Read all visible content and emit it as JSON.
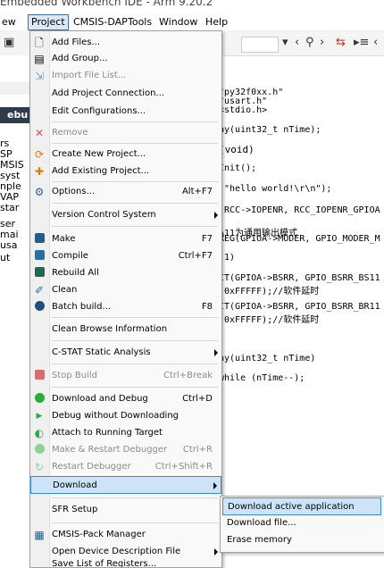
{
  "window": {
    "title": "Embedded Workbench IDE - Arm 9.20.2"
  },
  "menubar": [
    "ew",
    "Project",
    "CMSIS-DAP",
    "Tools",
    "Window",
    "Help"
  ],
  "left_tree": [
    "rs",
    "SP",
    "MSIS",
    "syst",
    "nple",
    "VAP",
    "star",
    "ser",
    "mai",
    "usa",
    "ut"
  ],
  "left_header": "ebu",
  "code_lines": [
    {
      "text": "\"py32f0xx.h\"",
      "cls": "s"
    },
    {
      "text": "\"usart.h\"",
      "cls": "s"
    },
    {
      "text": "<stdio.h>",
      "cls": "s"
    },
    {
      "text": "ay(uint32_t nTime);",
      "cls": ""
    },
    {
      "text": "(void)",
      "cls": "k"
    },
    {
      "text": "Init();",
      "cls": ""
    },
    {
      "text": "(\"hello world!\\r\\n\");",
      "cls": "s"
    },
    {
      "text": "(RCC->IOPENR, RCC_IOPENR_GPIOA",
      "cls": ""
    },
    {
      "text": "A11为通用输出模式",
      "cls": "c"
    },
    {
      "text": "REG(GPIOA->MODER, GPIO_MODER_M",
      "cls": ""
    },
    {
      "text": "(1)",
      "cls": ""
    },
    {
      "text": "IT(GPIOA->BSRR, GPIO_BSRR_BS11",
      "cls": ""
    },
    {
      "text": "(0xFFFFF);//软件延时",
      "cls": "c"
    },
    {
      "text": "IT(GPIOA->BSRR, GPIO_BSRR_BR11",
      "cls": ""
    },
    {
      "text": "(0xFFFFF);//软件延时",
      "cls": "c"
    },
    {
      "text": "ay(uint32_t nTime)",
      "cls": ""
    },
    {
      "text": "while (nTime--);",
      "cls": "k"
    }
  ],
  "menu": {
    "items": [
      {
        "label": "Add Files...",
        "shortcut": "",
        "icon": "add-files-icon",
        "disabled": false
      },
      {
        "label": "Add Group...",
        "shortcut": "",
        "icon": "add-group-icon",
        "disabled": false
      },
      {
        "label": "Import File List...",
        "shortcut": "",
        "icon": "import-file-list-icon",
        "disabled": true
      },
      {
        "label": "Add Project Connection...",
        "shortcut": "",
        "icon": "",
        "disabled": false
      },
      {
        "label": "Edit Configurations...",
        "shortcut": "",
        "icon": "",
        "disabled": false
      },
      {
        "label": "Remove",
        "shortcut": "",
        "icon": "remove-icon",
        "disabled": true
      },
      {
        "label": "Create New Project...",
        "shortcut": "",
        "icon": "create-project-icon",
        "disabled": false
      },
      {
        "label": "Add Existing Project...",
        "shortcut": "",
        "icon": "add-existing-project-icon",
        "disabled": false
      },
      {
        "label": "Options...",
        "shortcut": "Alt+F7",
        "icon": "gear-icon",
        "disabled": false
      },
      {
        "label": "Version Control System",
        "shortcut": "",
        "icon": "",
        "disabled": false,
        "submenu": true
      },
      {
        "label": "Make",
        "shortcut": "F7",
        "icon": "make-icon",
        "disabled": false
      },
      {
        "label": "Compile",
        "shortcut": "Ctrl+F7",
        "icon": "compile-icon",
        "disabled": false
      },
      {
        "label": "Rebuild All",
        "shortcut": "",
        "icon": "rebuild-icon",
        "disabled": false
      },
      {
        "label": "Clean",
        "shortcut": "",
        "icon": "clean-icon",
        "disabled": false
      },
      {
        "label": "Batch build...",
        "shortcut": "F8",
        "icon": "batch-build-icon",
        "disabled": false
      },
      {
        "label": "Clean Browse Information",
        "shortcut": "",
        "icon": "",
        "disabled": false
      },
      {
        "label": "C-STAT Static Analysis",
        "shortcut": "",
        "icon": "",
        "disabled": false,
        "submenu": true
      },
      {
        "label": "Stop Build",
        "shortcut": "Ctrl+Break",
        "icon": "stop-build-icon",
        "disabled": true
      },
      {
        "label": "Download and Debug",
        "shortcut": "Ctrl+D",
        "icon": "download-debug-icon",
        "disabled": false
      },
      {
        "label": "Debug without Downloading",
        "shortcut": "",
        "icon": "debug-no-download-icon",
        "disabled": false
      },
      {
        "label": "Attach to Running Target",
        "shortcut": "",
        "icon": "attach-target-icon",
        "disabled": false
      },
      {
        "label": "Make & Restart Debugger",
        "shortcut": "Ctrl+R",
        "icon": "make-restart-icon",
        "disabled": true
      },
      {
        "label": "Restart Debugger",
        "shortcut": "Ctrl+Shift+R",
        "icon": "restart-debugger-icon",
        "disabled": true
      },
      {
        "label": "Download",
        "shortcut": "",
        "icon": "",
        "disabled": false,
        "submenu": true,
        "highlighted": true
      },
      {
        "label": "SFR Setup",
        "shortcut": "",
        "icon": "",
        "disabled": false
      },
      {
        "label": "CMSIS-Pack Manager",
        "shortcut": "",
        "icon": "cmsis-pack-icon",
        "disabled": false
      },
      {
        "label": "Open Device Description File",
        "shortcut": "",
        "icon": "",
        "disabled": false,
        "submenu": true
      },
      {
        "label": "Save List of Registers...",
        "shortcut": "",
        "icon": "",
        "disabled": false
      }
    ]
  },
  "submenu": {
    "items": [
      {
        "label": "Download active application",
        "highlighted": true
      },
      {
        "label": "Download file..."
      },
      {
        "label": "Erase memory"
      }
    ]
  },
  "colors": {
    "menu_bg": "#f9f9f9",
    "highlight_bg": "#cde3f7",
    "highlight_border": "#3a8ad4",
    "disabled_text": "#8b8b8b"
  }
}
